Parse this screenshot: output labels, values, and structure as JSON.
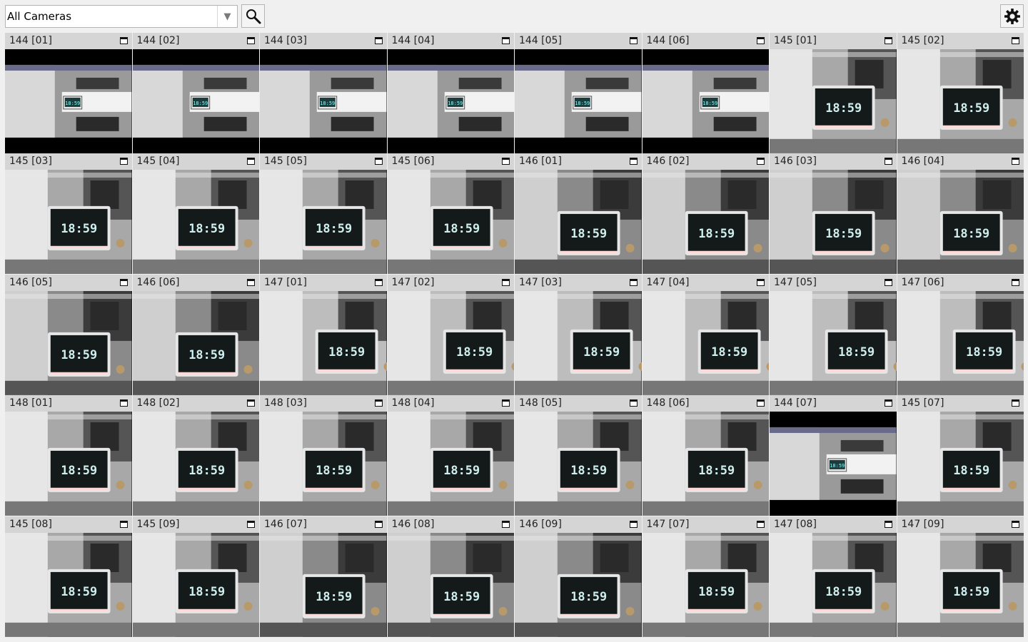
{
  "toolbar": {
    "camera_filter": {
      "value": "All Cameras"
    },
    "search_icon": "search-icon",
    "settings_icon": "gear-icon"
  },
  "tiles": [
    {
      "name": "144 [01]",
      "variant": "wide",
      "clock": "18:59"
    },
    {
      "name": "144 [02]",
      "variant": "wide",
      "clock": "18:59"
    },
    {
      "name": "144 [03]",
      "variant": "wide",
      "clock": "18:59"
    },
    {
      "name": "144 [04]",
      "variant": "wide",
      "clock": "18:59"
    },
    {
      "name": "144 [05]",
      "variant": "wide",
      "clock": "18:59"
    },
    {
      "name": "144 [06]",
      "variant": "wide",
      "clock": "18:59"
    },
    {
      "name": "145 [01]",
      "variant": "close",
      "clock": "18:59"
    },
    {
      "name": "145 [02]",
      "variant": "close",
      "clock": "18:59"
    },
    {
      "name": "145 [03]",
      "variant": "close",
      "clock": "18:59"
    },
    {
      "name": "145 [04]",
      "variant": "close",
      "clock": "18:59"
    },
    {
      "name": "145 [05]",
      "variant": "close",
      "clock": "18:59"
    },
    {
      "name": "145 [06]",
      "variant": "close",
      "clock": "18:59"
    },
    {
      "name": "146 [01]",
      "variant": "low",
      "clock": "18:59"
    },
    {
      "name": "146 [02]",
      "variant": "low",
      "clock": "18:59"
    },
    {
      "name": "146 [03]",
      "variant": "low",
      "clock": "18:59"
    },
    {
      "name": "146 [04]",
      "variant": "low",
      "clock": "18:59"
    },
    {
      "name": "146 [05]",
      "variant": "low",
      "clock": "18:59"
    },
    {
      "name": "146 [06]",
      "variant": "low",
      "clock": "18:59"
    },
    {
      "name": "147 [01]",
      "variant": "side",
      "clock": "18:59"
    },
    {
      "name": "147 [02]",
      "variant": "side",
      "clock": "18:59"
    },
    {
      "name": "147 [03]",
      "variant": "side",
      "clock": "18:59"
    },
    {
      "name": "147 [04]",
      "variant": "side",
      "clock": "18:59"
    },
    {
      "name": "147 [05]",
      "variant": "side",
      "clock": "18:59"
    },
    {
      "name": "147 [06]",
      "variant": "side",
      "clock": "18:59"
    },
    {
      "name": "148 [01]",
      "variant": "close",
      "clock": "18:59"
    },
    {
      "name": "148 [02]",
      "variant": "close",
      "clock": "18:59"
    },
    {
      "name": "148 [03]",
      "variant": "close",
      "clock": "18:59"
    },
    {
      "name": "148 [04]",
      "variant": "close",
      "clock": "18:59"
    },
    {
      "name": "148 [05]",
      "variant": "close",
      "clock": "18:59"
    },
    {
      "name": "148 [06]",
      "variant": "close",
      "clock": "18:59"
    },
    {
      "name": "144 [07]",
      "variant": "wide",
      "clock": "18:59"
    },
    {
      "name": "145 [07]",
      "variant": "close",
      "clock": "18:59"
    },
    {
      "name": "145 [08]",
      "variant": "close",
      "clock": "18:59"
    },
    {
      "name": "145 [09]",
      "variant": "close",
      "clock": "18:59"
    },
    {
      "name": "146 [07]",
      "variant": "low",
      "clock": "18:59"
    },
    {
      "name": "146 [08]",
      "variant": "low",
      "clock": "18:59"
    },
    {
      "name": "146 [09]",
      "variant": "low",
      "clock": "18:59"
    },
    {
      "name": "147 [07]",
      "variant": "close",
      "clock": "18:59"
    },
    {
      "name": "147 [08]",
      "variant": "close",
      "clock": "18:59"
    },
    {
      "name": "147 [09]",
      "variant": "close",
      "clock": "18:59"
    }
  ]
}
